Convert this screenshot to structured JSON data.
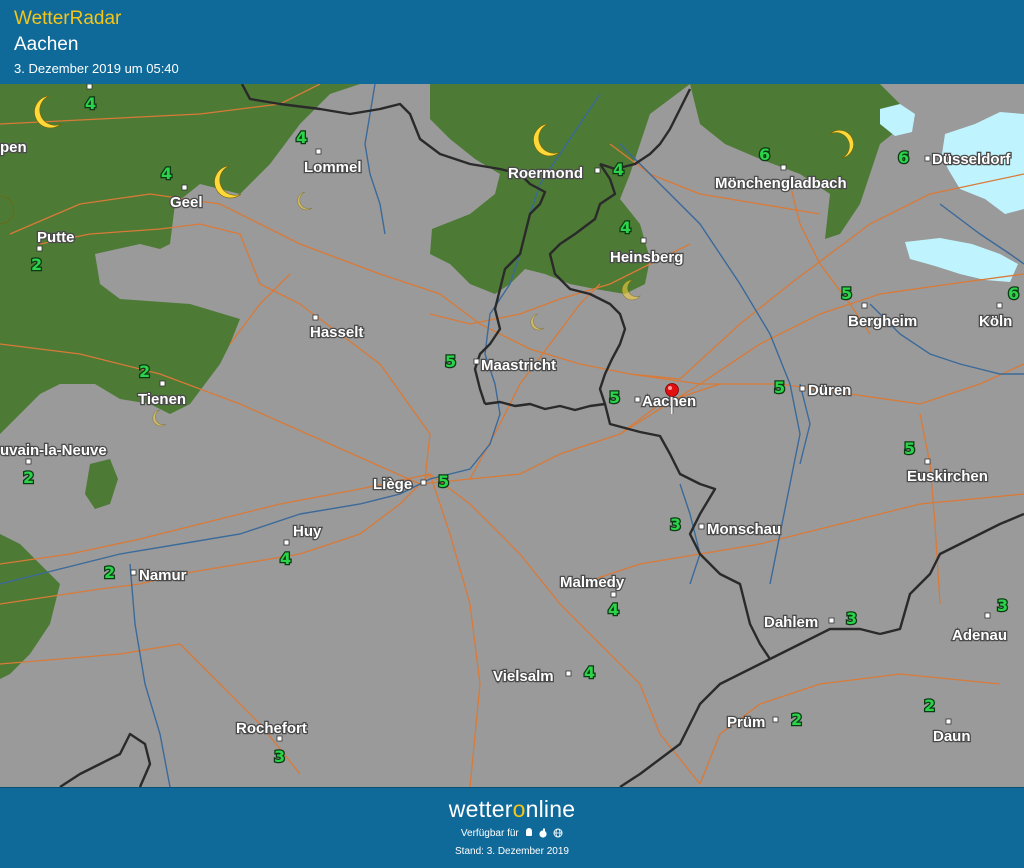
{
  "header": {
    "app_title": "WetterRadar",
    "location": "Aachen",
    "datetime": "3. Dezember 2019 um 05:40"
  },
  "colors": {
    "header_bg": "#0f6a9a",
    "app_title": "#f5c518",
    "map_bg": "#9a9a9a",
    "forest": "#4d7a35",
    "road": "#d97a38",
    "river": "#3b6a9a",
    "border": "#2a2a2a",
    "temperature": "#2bd24a",
    "snow": "#bff4ff",
    "moon": "#ffd83a"
  },
  "map": {
    "marker": {
      "icon": "location-pin-icon",
      "label": "Aachen"
    },
    "places": [
      {
        "name": "Lommel"
      },
      {
        "name": "Roermond"
      },
      {
        "name": "Mönchengladbach"
      },
      {
        "name": "Düsseldorf"
      },
      {
        "name": "Geel"
      },
      {
        "name": "Putte"
      },
      {
        "name": "Heinsberg"
      },
      {
        "name": "Hasselt"
      },
      {
        "name": "Maastricht"
      },
      {
        "name": "Bergheim"
      },
      {
        "name": "Köln"
      },
      {
        "name": "Tienen"
      },
      {
        "name": "Aachen"
      },
      {
        "name": "Düren"
      },
      {
        "name": "uvain-la-Neuve"
      },
      {
        "name": "Euskirchen"
      },
      {
        "name": "Liège"
      },
      {
        "name": "Huy"
      },
      {
        "name": "Monschau"
      },
      {
        "name": "Namur"
      },
      {
        "name": "Malmedy"
      },
      {
        "name": "Dahlem"
      },
      {
        "name": "Adenau"
      },
      {
        "name": "Vielsalm"
      },
      {
        "name": "Prüm"
      },
      {
        "name": "Rochefort"
      },
      {
        "name": "Daun"
      },
      {
        "name": "pen"
      }
    ],
    "temperatures": [
      "4",
      "4",
      "4",
      "6",
      "6",
      "4",
      "2",
      "4",
      "5",
      "5",
      "6",
      "2",
      "5",
      "5",
      "5",
      "2",
      "5",
      "4",
      "3",
      "2",
      "4",
      "3",
      "3",
      "4",
      "2",
      "2",
      "3"
    ]
  },
  "footer": {
    "brand_pre": "wetter",
    "brand_o": "o",
    "brand_post": "nline",
    "available": "Verfügbar für",
    "platforms": [
      "android-icon",
      "apple-icon",
      "web-icon"
    ],
    "stand": "Stand: 3. Dezember 2019"
  }
}
